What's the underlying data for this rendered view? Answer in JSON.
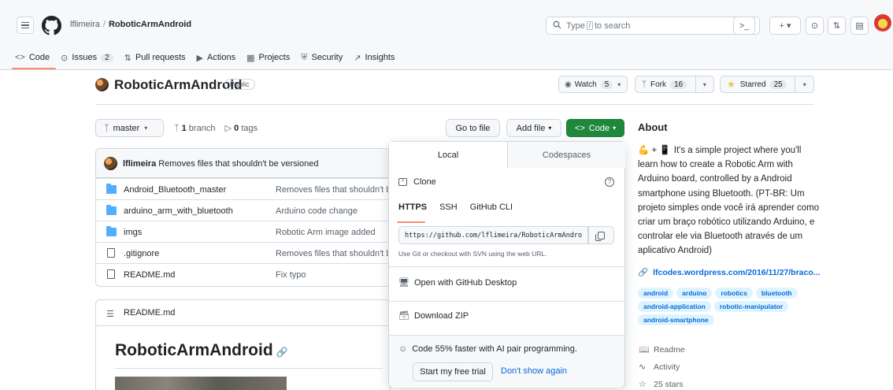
{
  "header": {
    "owner": "lflimeira",
    "separator": "/",
    "repo": "RoboticArmAndroid",
    "search_prefix": "Type",
    "search_key": "/",
    "search_suffix": "to search",
    "terminal_label": ">_",
    "plus_label": "+ ▾",
    "issues_icon_label": "⊙",
    "pr_icon_label": "⇅",
    "inbox_icon_label": "▤"
  },
  "repo_nav": [
    {
      "icon": "<>",
      "label": "Code",
      "counter": ""
    },
    {
      "icon": "⊙",
      "label": "Issues",
      "counter": "2"
    },
    {
      "icon": "⇅",
      "label": "Pull requests",
      "counter": ""
    },
    {
      "icon": "▶",
      "label": "Actions",
      "counter": ""
    },
    {
      "icon": "▦",
      "label": "Projects",
      "counter": ""
    },
    {
      "icon": "⛨",
      "label": "Security",
      "counter": ""
    },
    {
      "icon": "↗",
      "label": "Insights",
      "counter": ""
    }
  ],
  "repo_header": {
    "title": "RoboticArmAndroid",
    "visibility": "Public",
    "watch_label": "Watch",
    "watch_count": "5",
    "fork_label": "Fork",
    "fork_count": "16",
    "star_label": "Starred",
    "star_count": "25"
  },
  "branch_bar": {
    "branch": "master",
    "branch_count": "1",
    "branch_word": "branch",
    "tag_count": "0",
    "tag_word": "tags",
    "goto_file": "Go to file",
    "add_file": "Add file",
    "code_button": "Code"
  },
  "commit": {
    "author": "lflimeira",
    "message": "Removes files that shouldn't be versioned"
  },
  "files": [
    {
      "type": "folder",
      "name": "Android_Bluetooth_master",
      "message": "Removes files that shouldn't be"
    },
    {
      "type": "folder",
      "name": "arduino_arm_with_bluetooth",
      "message": "Arduino code change"
    },
    {
      "type": "folder",
      "name": "imgs",
      "message": "Robotic Arm image added"
    },
    {
      "type": "file",
      "name": ".gitignore",
      "message": "Removes files that shouldn't be"
    },
    {
      "type": "file",
      "name": "README.md",
      "message": "Fix typo"
    }
  ],
  "readme": {
    "filename": "README.md",
    "heading": "RoboticArmAndroid",
    "anchor": "✂"
  },
  "clone_popup": {
    "tab_local": "Local",
    "tab_codespaces": "Codespaces",
    "clone_label": "Clone",
    "help": "?",
    "protocols": [
      "HTTPS",
      "SSH",
      "GitHub CLI"
    ],
    "url": "https://github.com/lflimeira/RoboticArmAndroid.git",
    "url_note": "Use Git or checkout with SVN using the web URL.",
    "open_desktop": "Open with GitHub Desktop",
    "download_zip": "Download ZIP",
    "ai_text": "Code 55% faster with AI pair programming.",
    "trial_button": "Start my free trial",
    "dont_show": "Don't show again"
  },
  "about": {
    "title": "About",
    "description_emoji": "💪 + 📱",
    "description": "It's a simple project where you'll learn how to create a Robotic Arm with Arduino board, controlled by a Android smartphone using Bluetooth. (PT-BR: Um projeto simples onde você irá aprender como criar um braço robótico utilizando Arduino, e controlar ele via Bluetooth através de um aplicativo Android)",
    "link": "lfcodes.wordpress.com/2016/11/27/braco...",
    "topics": [
      "android",
      "arduino",
      "robotics",
      "bluetooth",
      "android-application",
      "robotic-manipulator",
      "android-smartphone"
    ],
    "readme_label": "Readme",
    "activity_label": "Activity",
    "stars_label": "25 stars"
  },
  "colors": {
    "primary_green": "#1f883d",
    "link_blue": "#0969da",
    "nav_underline": "#fd8c73",
    "folder_blue": "#54aeff"
  }
}
